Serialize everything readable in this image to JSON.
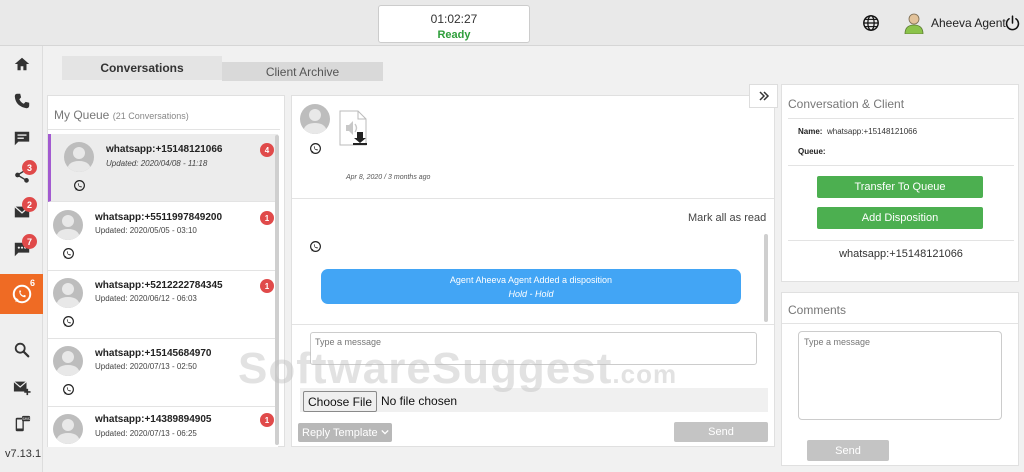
{
  "topbar": {
    "timer": "01:02:27",
    "status": "Ready",
    "status_color": "#2e9e3a",
    "agent_name": "Aheeva Agent"
  },
  "nav": {
    "items": [
      {
        "icon": "home-icon"
      },
      {
        "icon": "phone-icon"
      },
      {
        "icon": "chat-icon"
      },
      {
        "icon": "share-icon",
        "badge": "3"
      },
      {
        "icon": "email-icon",
        "badge": "2"
      },
      {
        "icon": "sms-icon",
        "badge": "7"
      },
      {
        "icon": "whatsapp-icon",
        "badge": "6",
        "active": true
      },
      {
        "icon": "search-icon"
      },
      {
        "icon": "compose-email-icon"
      },
      {
        "icon": "mobile-sms-icon"
      }
    ],
    "version": "v7.13.1",
    "accent": "#ef6b24"
  },
  "tabs": {
    "conversations": "Conversations",
    "client_archive": "Client Archive"
  },
  "queue": {
    "title": "My Queue",
    "count": "(21 Conversations)",
    "items": [
      {
        "name": "whatsapp:+15148121066",
        "updated": "Updated: 2020/04/08 - 11:18",
        "badge": "4",
        "selected": true
      },
      {
        "name": "whatsapp:+5511997849200",
        "updated": "Updated: 2020/05/05 - 03:10",
        "badge": "1"
      },
      {
        "name": "whatsapp:+5212222784345",
        "updated": "Updated: 2020/06/12 - 06:03",
        "badge": "1"
      },
      {
        "name": "whatsapp:+15145684970",
        "updated": "Updated: 2020/07/13 - 02:50",
        "badge": ""
      },
      {
        "name": "whatsapp:+14389894905",
        "updated": "Updated: 2020/07/13 - 06:25",
        "badge": "1"
      }
    ]
  },
  "chat": {
    "message_meta": "Apr 8, 2020 / 3 months ago",
    "mark_all_read": "Mark all as read",
    "disposition_line1": "Agent Aheeva Agent Added a disposition",
    "disposition_line2": "Hold - Hold",
    "input_placeholder": "Type a message",
    "choose_file": "Choose File",
    "no_file": "No file chosen",
    "reply_template": "Reply Template",
    "send": "Send",
    "bubble_color": "#42a5f5"
  },
  "client": {
    "title": "Conversation & Client",
    "name_label": "Name:",
    "name_value": "whatsapp:+15148121066",
    "queue_label": "Queue:",
    "queue_value": "",
    "transfer_button": "Transfer To Queue",
    "disposition_button": "Add Disposition",
    "number": "whatsapp:+15148121066",
    "button_color": "#4caf50"
  },
  "comments": {
    "title": "Comments",
    "placeholder": "Type a message",
    "send": "Send"
  },
  "watermark": {
    "main": "SoftwareSuggest",
    "suffix": ".com"
  }
}
